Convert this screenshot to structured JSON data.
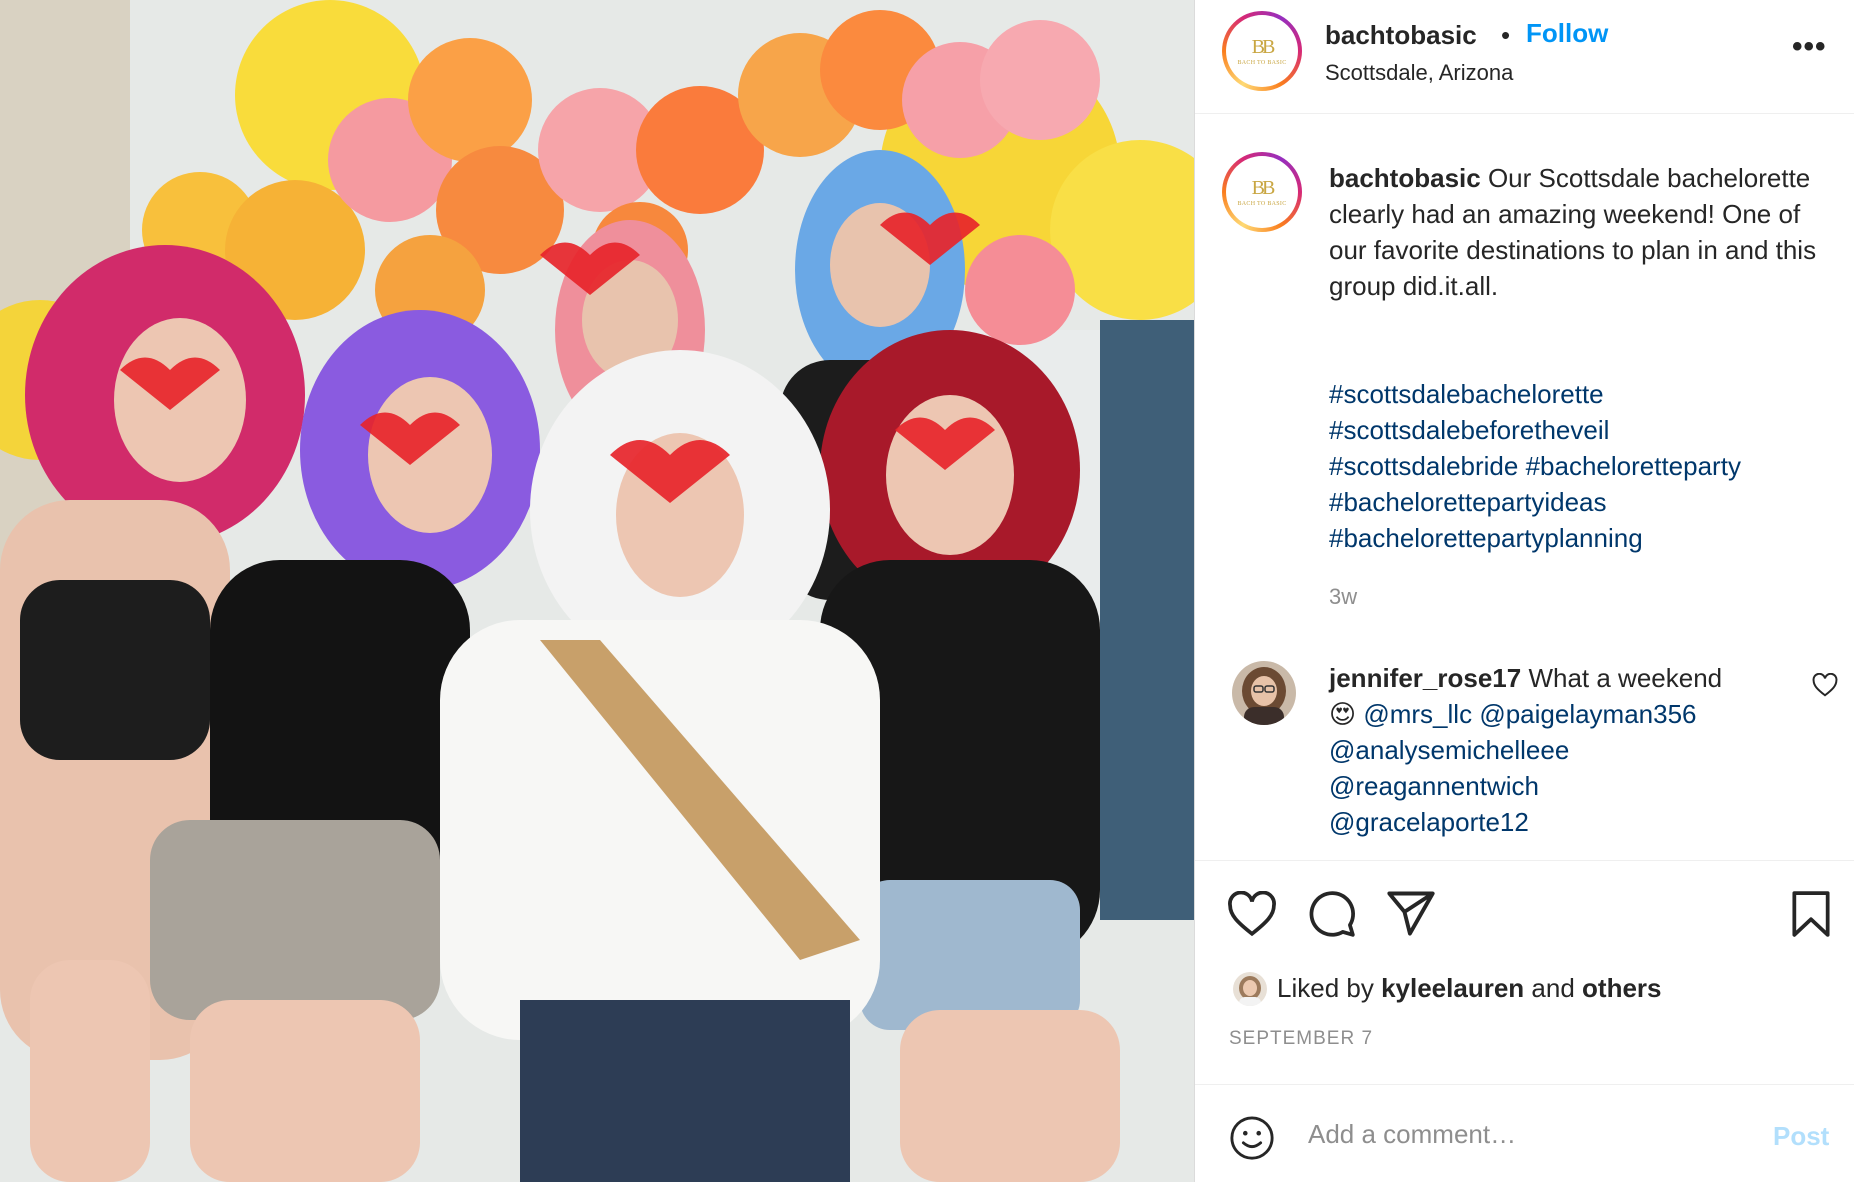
{
  "post": {
    "username": "bachtobasic",
    "separator": "•",
    "follow_label": "Follow",
    "location": "Scottsdale, Arizona",
    "more_label": "•••",
    "avatar_monogram": "BB",
    "avatar_subtext": "BACH TO BASIC"
  },
  "caption": {
    "username": "bachtobasic",
    "text": "Our Scottsdale bachelorette clearly had an amazing weekend! One of our favorite destinations to plan in and this group did.it.all.",
    "hashtags": [
      "#scottsdalebachelorette",
      "#scottsdalebeforetheveil",
      "#scottsdalebride",
      "#bachelorettepartyideas",
      "#bachelorettepartyplanning"
    ],
    "hashtag_extra": "#bacheloretteparty",
    "time_ago": "3w"
  },
  "comment": {
    "username": "jennifer_rose17",
    "text": "What a weekend",
    "emoji": "😍",
    "mentions": [
      "@mrs_llc",
      "@paigelayman356",
      "@analysemichelleee",
      "@reagannentwich",
      "@gracelaporte12"
    ]
  },
  "likes": {
    "prefix": "Liked by",
    "user": "kyleelauren",
    "joiner": "and",
    "others": "others"
  },
  "date": "SEPTEMBER 7",
  "add_comment": {
    "placeholder": "Add a comment…",
    "post_label": "Post"
  },
  "colors": {
    "follow": "#0095f6",
    "link": "#00376b",
    "muted": "#8e8e8e",
    "post_disabled": "#b2dffc",
    "brand_gold": "#c9a642"
  },
  "icons": [
    "more-icon",
    "heart-icon",
    "comment-icon",
    "share-icon",
    "bookmark-icon",
    "emoji-icon",
    "like-comment-icon"
  ]
}
